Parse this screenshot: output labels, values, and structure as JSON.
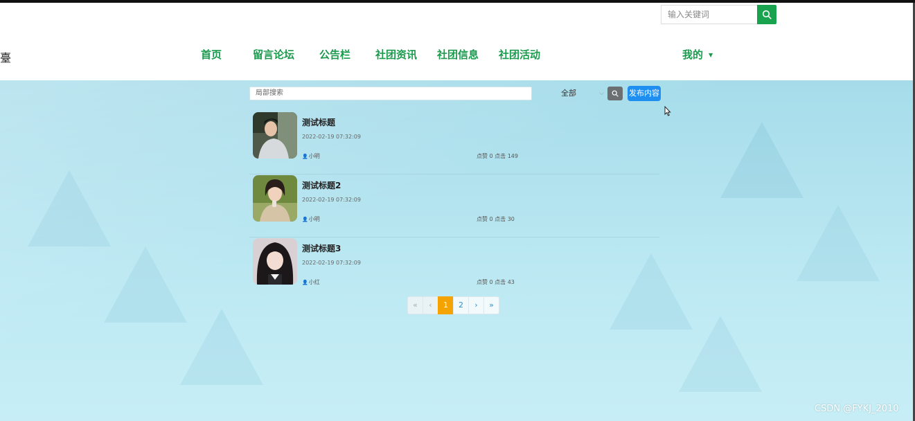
{
  "header": {
    "logo_fragment": "臺",
    "nav": [
      {
        "label": "首页"
      },
      {
        "label": "留言论坛"
      },
      {
        "label": "公告栏"
      },
      {
        "label": "社团资讯"
      },
      {
        "label": "社团信息"
      },
      {
        "label": "社团活动"
      }
    ],
    "my_label": "我的",
    "search_placeholder": "输入关键词"
  },
  "toolbar": {
    "local_search_placeholder": "局部搜索",
    "filter_value": "全部",
    "publish_label": "发布内容"
  },
  "posts": [
    {
      "title": "测试标题",
      "time": "2022-02-19 07:32:09",
      "author": "小明",
      "stats": "点赞 0 点击 149"
    },
    {
      "title": "测试标题2",
      "time": "2022-02-19 07:32:09",
      "author": "小明",
      "stats": "点赞 0 点击 30"
    },
    {
      "title": "测试标题3",
      "time": "2022-02-19 07:32:09",
      "author": "小红",
      "stats": "点赞 0 点击 43"
    }
  ],
  "pagination": {
    "first": "«",
    "prev": "‹",
    "pages": [
      "1",
      "2"
    ],
    "current": "1",
    "next": "›",
    "last": "»"
  },
  "watermark": "CSDN @FYKJ_2010",
  "colors": {
    "nav_green": "#1a9a4d",
    "search_green": "#1aa34f",
    "publish_blue": "#1e8ff0",
    "active_page": "#f5a300"
  }
}
